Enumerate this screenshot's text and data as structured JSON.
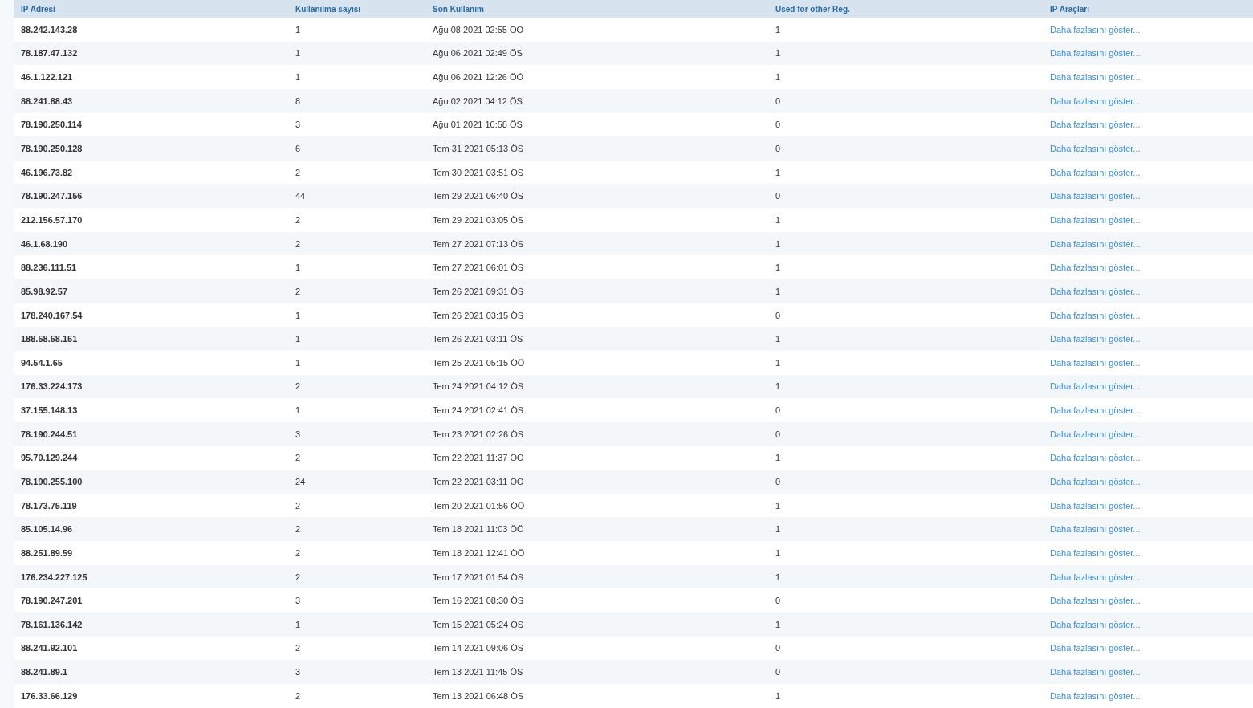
{
  "table": {
    "columns": [
      "IP Adresi",
      "Kullanılma sayısı",
      "Son Kullanım",
      "Used for other Reg.",
      "IP Araçları"
    ],
    "rows": [
      {
        "ip": "88.242.143.28",
        "count": "1",
        "last_used": "Ağu 08 2021 02:55 ÖÖ",
        "other_reg": "1",
        "tools": "Daha fazlasını göster..."
      },
      {
        "ip": "78.187.47.132",
        "count": "1",
        "last_used": "Ağu 06 2021 02:49 ÖS",
        "other_reg": "1",
        "tools": "Daha fazlasını göster..."
      },
      {
        "ip": "46.1.122.121",
        "count": "1",
        "last_used": "Ağu 06 2021 12:26 ÖÖ",
        "other_reg": "1",
        "tools": "Daha fazlasını göster..."
      },
      {
        "ip": "88.241.88.43",
        "count": "8",
        "last_used": "Ağu 02 2021 04:12 ÖS",
        "other_reg": "0",
        "tools": "Daha fazlasını göster..."
      },
      {
        "ip": "78.190.250.114",
        "count": "3",
        "last_used": "Ağu 01 2021 10:58 ÖS",
        "other_reg": "0",
        "tools": "Daha fazlasını göster..."
      },
      {
        "ip": "78.190.250.128",
        "count": "6",
        "last_used": "Tem 31 2021 05:13 ÖS",
        "other_reg": "0",
        "tools": "Daha fazlasını göster..."
      },
      {
        "ip": "46.196.73.82",
        "count": "2",
        "last_used": "Tem 30 2021 03:51 ÖS",
        "other_reg": "1",
        "tools": "Daha fazlasını göster..."
      },
      {
        "ip": "78.190.247.156",
        "count": "44",
        "last_used": "Tem 29 2021 06:40 ÖS",
        "other_reg": "0",
        "tools": "Daha fazlasını göster..."
      },
      {
        "ip": "212.156.57.170",
        "count": "2",
        "last_used": "Tem 29 2021 03:05 ÖS",
        "other_reg": "1",
        "tools": "Daha fazlasını göster..."
      },
      {
        "ip": "46.1.68.190",
        "count": "2",
        "last_used": "Tem 27 2021 07:13 ÖS",
        "other_reg": "1",
        "tools": "Daha fazlasını göster..."
      },
      {
        "ip": "88.236.111.51",
        "count": "1",
        "last_used": "Tem 27 2021 06:01 ÖS",
        "other_reg": "1",
        "tools": "Daha fazlasını göster..."
      },
      {
        "ip": "85.98.92.57",
        "count": "2",
        "last_used": "Tem 26 2021 09:31 ÖS",
        "other_reg": "1",
        "tools": "Daha fazlasını göster..."
      },
      {
        "ip": "178.240.167.54",
        "count": "1",
        "last_used": "Tem 26 2021 03:15 ÖS",
        "other_reg": "0",
        "tools": "Daha fazlasını göster..."
      },
      {
        "ip": "188.58.58.151",
        "count": "1",
        "last_used": "Tem 26 2021 03:11 ÖS",
        "other_reg": "1",
        "tools": "Daha fazlasını göster..."
      },
      {
        "ip": "94.54.1.65",
        "count": "1",
        "last_used": "Tem 25 2021 05:15 ÖÖ",
        "other_reg": "1",
        "tools": "Daha fazlasını göster..."
      },
      {
        "ip": "176.33.224.173",
        "count": "2",
        "last_used": "Tem 24 2021 04:12 ÖS",
        "other_reg": "1",
        "tools": "Daha fazlasını göster..."
      },
      {
        "ip": "37.155.148.13",
        "count": "1",
        "last_used": "Tem 24 2021 02:41 ÖS",
        "other_reg": "0",
        "tools": "Daha fazlasını göster..."
      },
      {
        "ip": "78.190.244.51",
        "count": "3",
        "last_used": "Tem 23 2021 02:26 ÖS",
        "other_reg": "0",
        "tools": "Daha fazlasını göster..."
      },
      {
        "ip": "95.70.129.244",
        "count": "2",
        "last_used": "Tem 22 2021 11:37 ÖÖ",
        "other_reg": "1",
        "tools": "Daha fazlasını göster..."
      },
      {
        "ip": "78.190.255.100",
        "count": "24",
        "last_used": "Tem 22 2021 03:11 ÖÖ",
        "other_reg": "0",
        "tools": "Daha fazlasını göster..."
      },
      {
        "ip": "78.173.75.119",
        "count": "2",
        "last_used": "Tem 20 2021 01:56 ÖÖ",
        "other_reg": "1",
        "tools": "Daha fazlasını göster..."
      },
      {
        "ip": "85.105.14.96",
        "count": "2",
        "last_used": "Tem 18 2021 11:03 ÖÖ",
        "other_reg": "1",
        "tools": "Daha fazlasını göster..."
      },
      {
        "ip": "88.251.89.59",
        "count": "2",
        "last_used": "Tem 18 2021 12:41 ÖÖ",
        "other_reg": "1",
        "tools": "Daha fazlasını göster..."
      },
      {
        "ip": "176.234.227.125",
        "count": "2",
        "last_used": "Tem 17 2021 01:54 ÖS",
        "other_reg": "1",
        "tools": "Daha fazlasını göster..."
      },
      {
        "ip": "78.190.247.201",
        "count": "3",
        "last_used": "Tem 16 2021 08:30 ÖS",
        "other_reg": "0",
        "tools": "Daha fazlasını göster..."
      },
      {
        "ip": "78.161.136.142",
        "count": "1",
        "last_used": "Tem 15 2021 05:24 ÖS",
        "other_reg": "1",
        "tools": "Daha fazlasını göster..."
      },
      {
        "ip": "88.241.92.101",
        "count": "2",
        "last_used": "Tem 14 2021 09:06 ÖS",
        "other_reg": "0",
        "tools": "Daha fazlasını göster..."
      },
      {
        "ip": "88.241.89.1",
        "count": "3",
        "last_used": "Tem 13 2021 11:45 ÖS",
        "other_reg": "0",
        "tools": "Daha fazlasını göster..."
      },
      {
        "ip": "176.33.66.129",
        "count": "2",
        "last_used": "Tem 13 2021 06:48 ÖS",
        "other_reg": "1",
        "tools": "Daha fazlasını göster..."
      }
    ]
  }
}
